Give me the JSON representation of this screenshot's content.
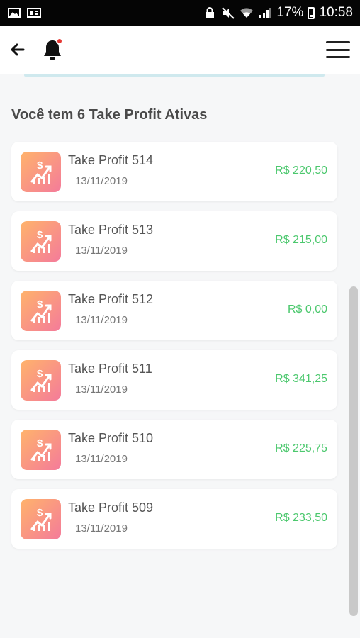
{
  "status_bar": {
    "battery": "17%",
    "time": "10:58",
    "icons": [
      "image-icon",
      "gallery-icon",
      "lock-icon",
      "mute-icon",
      "wifi-icon",
      "signal-icon"
    ]
  },
  "app_bar": {
    "back_icon": "arrow-left-icon",
    "bell_icon": "bell-icon",
    "menu_icon": "hamburger-menu-icon",
    "notification_dot": true
  },
  "main": {
    "heading": "Você tem 6 Take Profit Ativas",
    "items": [
      {
        "title": "Take Profit 514",
        "date": "13/11/2019",
        "amount": "R$ 220,50"
      },
      {
        "title": "Take Profit 513",
        "date": "13/11/2019",
        "amount": "R$ 215,00"
      },
      {
        "title": "Take Profit 512",
        "date": "13/11/2019",
        "amount": "R$ 0,00"
      },
      {
        "title": "Take Profit 511",
        "date": "13/11/2019",
        "amount": "R$ 341,25"
      },
      {
        "title": "Take Profit 510",
        "date": "13/11/2019",
        "amount": "R$ 225,75"
      },
      {
        "title": "Take Profit 509",
        "date": "13/11/2019",
        "amount": "R$ 233,50"
      }
    ]
  },
  "colors": {
    "amount": "#4cc86e",
    "icon_gradient_start": "#ffb36b",
    "icon_gradient_end": "#f47b9a",
    "notification_dot": "#e53935"
  }
}
